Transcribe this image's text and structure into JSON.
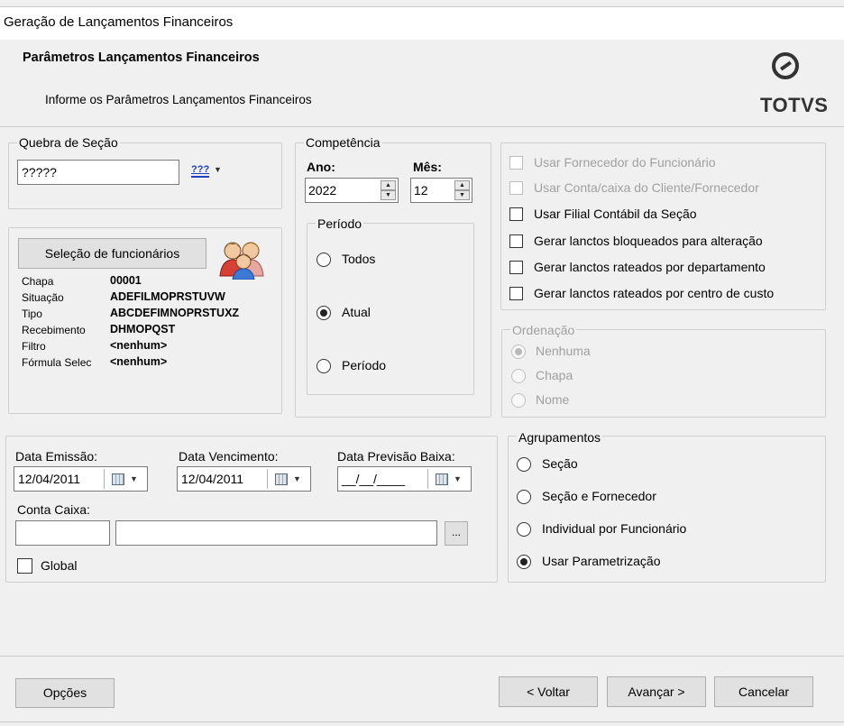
{
  "window": {
    "title": "Geração de Lançamentos Financeiros"
  },
  "header": {
    "title": "Parâmetros Lançamentos Financeiros",
    "subtitle": "Informe os Parâmetros Lançamentos Financeiros",
    "logo_text": "TOTVS"
  },
  "quebra": {
    "legend": "Quebra de Seção",
    "value": "?????",
    "selector_icon_text": "???"
  },
  "selecao": {
    "button": "Seleção de funcionários",
    "fields": [
      {
        "label": "Chapa",
        "value": "00001"
      },
      {
        "label": "Situação",
        "value": "ADEFILMOPRSTUVW"
      },
      {
        "label": "Tipo",
        "value": "ABCDEFIMNOPRSTUXZ"
      },
      {
        "label": "Recebimento",
        "value": "DHMOPQST"
      },
      {
        "label": "Filtro",
        "value": "<nenhum>"
      },
      {
        "label": "Fórmula Selec",
        "value": "<nenhum>"
      }
    ]
  },
  "competencia": {
    "legend": "Competência",
    "ano_label": "Ano:",
    "ano_value": "2022",
    "mes_label": "Mês:",
    "mes_value": "12",
    "periodo": {
      "legend": "Período",
      "options": [
        "Todos",
        "Atual",
        "Período"
      ],
      "selected": "Atual"
    }
  },
  "options": {
    "checkboxes": [
      {
        "label": "Usar Fornecedor do Funcionário",
        "checked": false,
        "enabled": false
      },
      {
        "label": "Usar Conta/caixa do Cliente/Fornecedor",
        "checked": false,
        "enabled": false
      },
      {
        "label": "Usar Filial Contábil da Seção",
        "checked": false,
        "enabled": true
      },
      {
        "label": "Gerar lanctos bloqueados para alteração",
        "checked": false,
        "enabled": true
      },
      {
        "label": "Gerar lanctos rateados por departamento",
        "checked": false,
        "enabled": true
      },
      {
        "label": "Gerar lanctos rateados por centro de custo",
        "checked": false,
        "enabled": true
      }
    ]
  },
  "ordenacao": {
    "legend": "Ordenação",
    "options": [
      "Nenhuma",
      "Chapa",
      "Nome"
    ],
    "selected": "Nenhuma",
    "enabled": false
  },
  "datas": {
    "emissao_label": "Data Emissão:",
    "emissao_value": "12/04/2011",
    "vencimento_label": "Data Vencimento:",
    "vencimento_value": "12/04/2011",
    "previsao_label": "Data Previsão Baixa:",
    "previsao_value": "__/__/____",
    "conta_label": "Conta Caixa:",
    "conta_code": "",
    "conta_desc": "",
    "browse": "...",
    "global_label": "Global"
  },
  "agrupamentos": {
    "legend": "Agrupamentos",
    "options": [
      "Seção",
      "Seção e Fornecedor",
      "Individual por Funcionário",
      "Usar Parametrização"
    ],
    "selected": "Usar Parametrização"
  },
  "footer": {
    "opcoes": "Opções",
    "voltar": "< Voltar",
    "avancar": "Avançar >",
    "cancelar": "Cancelar"
  },
  "colors": {
    "background": "#f0f0f0",
    "border": "#cfcfcf",
    "disabled_text": "#a0a0a0",
    "link_blue": "#1c3fbf"
  }
}
